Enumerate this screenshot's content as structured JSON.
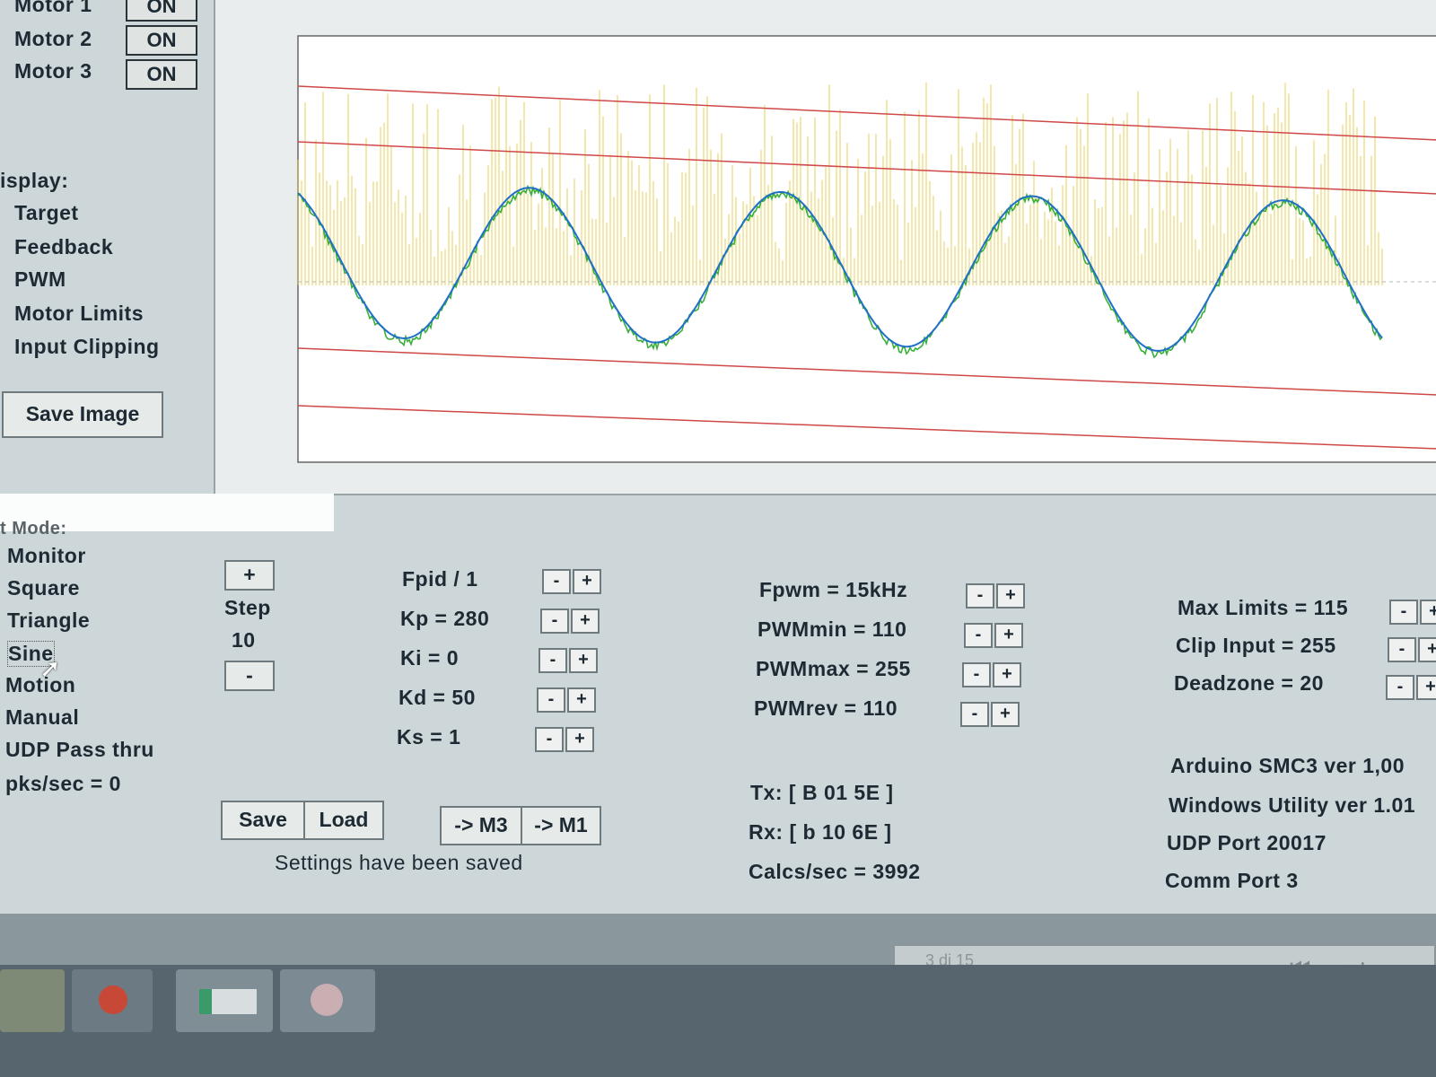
{
  "motors": [
    {
      "label": "Motor 1",
      "state": "ON"
    },
    {
      "label": "Motor 2",
      "state": "ON"
    },
    {
      "label": "Motor 3",
      "state": "ON"
    }
  ],
  "display": {
    "heading": "isplay:",
    "items": [
      "Target",
      "Feedback",
      "PWM",
      "Motor Limits",
      "Input Clipping"
    ],
    "save_image": "Save Image"
  },
  "mode": {
    "heading": "t Mode:",
    "items": [
      "Monitor",
      "Square",
      "Triangle",
      "Sine",
      "Motion",
      "Manual",
      "UDP Pass thru"
    ],
    "pks": "pks/sec = 0"
  },
  "step": {
    "plus": "+",
    "label": "Step",
    "value": "10",
    "minus": "-"
  },
  "pid": {
    "rows": [
      "Fpid / 1",
      "Kp = 280",
      "Ki = 0",
      "Kd = 50",
      "Ks = 1"
    ]
  },
  "pwm": {
    "rows": [
      "Fpwm = 15kHz",
      "PWMmin = 110",
      "PWMmax = 255",
      "PWMrev = 110"
    ]
  },
  "limits": {
    "rows": [
      "Max Limits = 115",
      "Clip Input = 255",
      "Deadzone = 20"
    ]
  },
  "buttons": {
    "save": "Save",
    "load": "Load",
    "to_m3": "-> M3",
    "to_m1": "-> M1",
    "minus": "-",
    "plus": "+"
  },
  "status": "Settings have been saved",
  "comms": {
    "tx": "Tx: [ B 01 5E ]",
    "rx": "Rx: [ b 10 6E ]",
    "calcs": "Calcs/sec = 3992"
  },
  "info": {
    "arduino": "Arduino SMC3 ver 1,00",
    "windows": "Windows Utility ver 1.01",
    "udp": "UDP Port 20017",
    "comm": "Comm Port 3"
  },
  "page_indicator": "3 di 15",
  "colors": {
    "limit_line": "#d04848",
    "target": "#2070c8",
    "feedback": "#38b038",
    "pwm": "#e0c020"
  }
}
